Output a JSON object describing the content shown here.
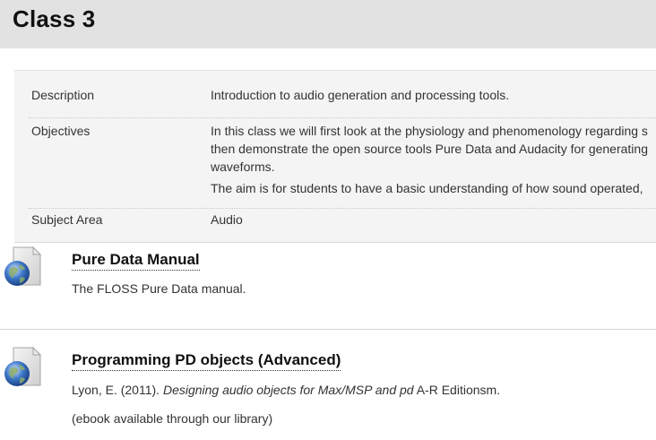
{
  "page": {
    "title": "Class 3"
  },
  "meta": {
    "description_label": "Description",
    "description_value": "Introduction to audio generation and processing tools.",
    "objectives_label": "Objectives",
    "objectives_p1_line1": "In this class we will first look at the physiology and phenomenology regarding s",
    "objectives_p1_line2": "then demonstrate the open source tools Pure Data and Audacity for generating",
    "objectives_p1_line3": "waveforms.",
    "objectives_p2": "The aim is for students to have a basic understanding of how sound operated,",
    "subject_label": "Subject Area",
    "subject_value": "Audio"
  },
  "items": [
    {
      "title": "Pure Data Manual",
      "text": "The FLOSS Pure Data manual.",
      "icon": "web-document-icon"
    },
    {
      "title": "Programming PD objects (Advanced)",
      "citation_prefix": "Lyon, E. (2011). ",
      "citation_title": "Designing audio objects for Max/MSP and pd",
      "citation_suffix": " A-R Editionsm.",
      "note": "(ebook available through our library)",
      "icon": "web-document-icon"
    }
  ]
}
